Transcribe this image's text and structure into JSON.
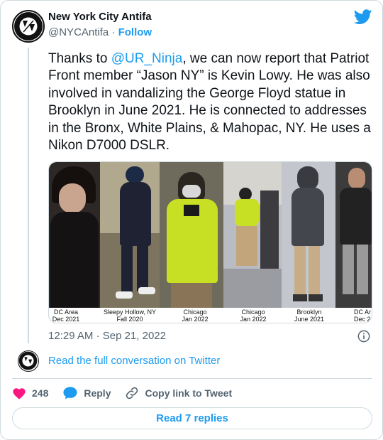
{
  "author": {
    "name": "New York City Antifa",
    "handle": "@NYCAntifa",
    "separator": "·",
    "follow_label": "Follow",
    "avatar_text_top": "NEW YORK CITY",
    "avatar_text_bottom": "ANTIFA"
  },
  "tweet": {
    "text_before": "Thanks to ",
    "mention": "@UR_Ninja",
    "text_after": ", we can now report that Patriot Front member “Jason NY” is Kevin Lowy. He was also involved in vandalizing the George Floyd statue in Brooklyn in June 2021. He is connected to addresses in the Bronx, White Plains, & Mahopac, NY. He uses a Nikon D7000 DSLR."
  },
  "media": {
    "photos": [
      {
        "place": "DC Area",
        "date": "Dec 2021"
      },
      {
        "place": "Sleepy Hollow, NY",
        "date": "Fall 2020"
      },
      {
        "place": "Chicago",
        "date": "Jan 2022"
      },
      {
        "place": "Chicago",
        "date": "Jan 2022"
      },
      {
        "place": "Brooklyn",
        "date": "June 2021"
      },
      {
        "place": "DC Ar",
        "date": "Dec 2("
      }
    ]
  },
  "meta": {
    "time": "12:29 AM",
    "separator": "·",
    "date": "Sep 21, 2022"
  },
  "conversation": {
    "read_full": "Read the full conversation on Twitter"
  },
  "actions": {
    "like_count": "248",
    "reply_label": "Reply",
    "copy_label": "Copy link to Tweet"
  },
  "replies": {
    "label": "Read 7 replies"
  },
  "colors": {
    "accent": "#1d9bf0",
    "like": "#f91880",
    "muted": "#536471"
  }
}
